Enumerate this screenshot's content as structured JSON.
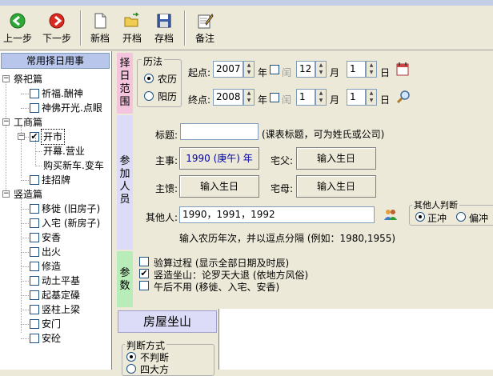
{
  "toolbar": {
    "prev": "上一步",
    "next": "下一步",
    "new": "新档",
    "open": "开档",
    "save": "存档",
    "note": "备注"
  },
  "tree": {
    "header": "常用择日用事",
    "nodes": [
      {
        "label": "祭祀篇",
        "checked": false
      },
      {
        "label": "祈福.酬神",
        "checked": false
      },
      {
        "label": "神佛开光.点眼",
        "checked": false
      },
      {
        "label": "工商篇",
        "checked": false
      },
      {
        "label": "开市",
        "checked": true
      },
      {
        "label": "开幕.营业",
        "checked": false
      },
      {
        "label": "购买新车.变车",
        "checked": false
      },
      {
        "label": "挂招牌",
        "checked": false
      },
      {
        "label": "竖造篇",
        "checked": false
      },
      {
        "label": "移徙 (旧房子)",
        "checked": false
      },
      {
        "label": "入宅 (新房子)",
        "checked": false
      },
      {
        "label": "安香",
        "checked": false
      },
      {
        "label": "出火",
        "checked": false
      },
      {
        "label": "修造",
        "checked": false
      },
      {
        "label": "动土平基",
        "checked": false
      },
      {
        "label": "起基定磉",
        "checked": false
      },
      {
        "label": "竖柱上梁",
        "checked": false
      },
      {
        "label": "安门",
        "checked": false
      },
      {
        "label": "安砼",
        "checked": false
      }
    ]
  },
  "date_range": {
    "section_label": "择日范围",
    "calendar_group": "历法",
    "lunar": "农历",
    "solar": "阳历",
    "selected": "农历",
    "start_label": "起点:",
    "end_label": "终点:",
    "start_year": "2007",
    "start_month": "12",
    "start_day": "1",
    "end_year": "2008",
    "end_month": "1",
    "end_day": "1",
    "year": "年",
    "leap": "闰",
    "month": "月",
    "day": "日"
  },
  "people": {
    "section_label": "参加人员",
    "title_label": "标题:",
    "title_value": "",
    "title_hint": "(课表标题，可为姓氏或公司)",
    "host_label": "主事:",
    "host_value": "1990 (庚午) 年",
    "father_label": "宅父:",
    "father_btn": "输入生日",
    "hostwife_label": "主馈:",
    "hostwife_btn": "输入生日",
    "mother_label": "宅母:",
    "mother_btn": "输入生日",
    "others_label": "其他人:",
    "others_value": "1990，1991，1992",
    "others_hint": "输入农历年次，并以逗点分隔 (例如：1980,1955)",
    "judge_group": "其他人判断",
    "judge_opt1": "正冲",
    "judge_opt2": "偏冲",
    "judge_selected": "正冲"
  },
  "params": {
    "section_label": "参数",
    "opt1": "验算过程 (显示全部日期及时辰)",
    "opt2": "竖造坐山：论罗天大退 (依地方风俗)",
    "opt3": "午后不用 (移徙、入宅、安香)",
    "checked": [
      false,
      true,
      false
    ]
  },
  "house": {
    "title": "房屋坐山",
    "judge_group": "判断方式",
    "opt1": "不判断",
    "opt2": "四大方",
    "selected": "不判断"
  },
  "colors": {
    "section_pink": "#f4c4dc",
    "section_lavender": "#dcdcf8",
    "section_green": "#b8ecb8",
    "tree_header": "#b9c6ec",
    "host_text": "#0000aa"
  }
}
